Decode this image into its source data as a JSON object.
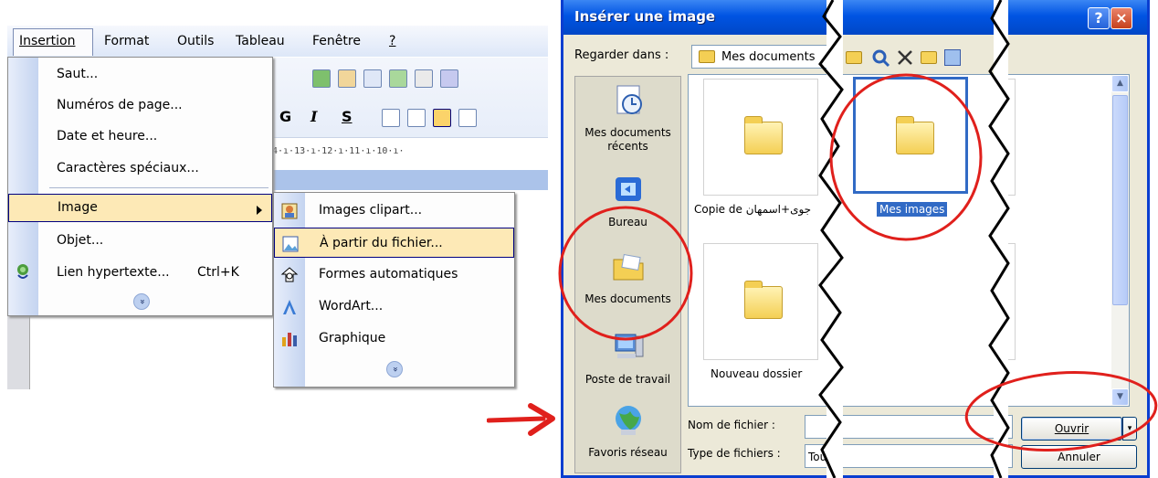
{
  "menubar": {
    "items": [
      {
        "label": "Insertion"
      },
      {
        "label": "Format"
      },
      {
        "label": "Outils"
      },
      {
        "label": "Tableau"
      },
      {
        "label": "Fenêtre"
      },
      {
        "label": "?"
      }
    ]
  },
  "toolbar": {
    "bold_label": "G",
    "italic_label": "I",
    "underline_label": "S",
    "ruler_text": "4·ı·13·ı·12·ı·11·ı·10·ı·"
  },
  "insert_menu": {
    "items": [
      {
        "label": "Saut..."
      },
      {
        "label": "Numéros de page..."
      },
      {
        "label": "Date et heure..."
      },
      {
        "label": "Caractères spéciaux..."
      },
      {
        "label": "Image"
      },
      {
        "label": "Objet..."
      },
      {
        "label": "Lien hypertexte..."
      }
    ],
    "shortcut_hyperlink": "Ctrl+K",
    "expand_glyph": "»"
  },
  "image_submenu": {
    "items": [
      {
        "label": "Images clipart...",
        "icon": "clipart-icon"
      },
      {
        "label": "À partir du fichier...",
        "icon": "picture-from-file-icon"
      },
      {
        "label": "Formes automatiques",
        "icon": "autoshapes-icon"
      },
      {
        "label": "WordArt...",
        "icon": "wordart-icon"
      },
      {
        "label": "Graphique",
        "icon": "chart-icon"
      }
    ],
    "expand_glyph": "»"
  },
  "dialog": {
    "title": "Insérer une image",
    "help_glyph": "?",
    "close_glyph": "×",
    "lookin_label": "Regarder dans :",
    "lookin_value": "Mes documents",
    "places": [
      {
        "label": "Mes documents récents",
        "icon": "recent-documents-icon"
      },
      {
        "label": "Bureau",
        "icon": "desktop-icon"
      },
      {
        "label": "Mes documents",
        "icon": "my-documents-icon"
      },
      {
        "label": "Poste de travail",
        "icon": "my-computer-icon"
      },
      {
        "label": "Favoris réseau",
        "icon": "network-places-icon"
      }
    ],
    "files": [
      {
        "name": "Copie de جوى+اسمهان"
      },
      {
        "name": "Mes images"
      },
      {
        "name": "Nouveau dossier"
      }
    ],
    "filename_label": "Nom de fichier :",
    "filename_value": "",
    "filetype_label": "Type de fichiers :",
    "filetype_value": "Tou",
    "open_label": "Ouvrir",
    "cancel_label": "Annuler",
    "scroll_up": "▲",
    "scroll_down": "▼"
  },
  "colors": {
    "highlight": "#fde9b6",
    "selection": "#316ac5",
    "title_blue": "#0054e3",
    "annotation_red": "#e0201c"
  }
}
